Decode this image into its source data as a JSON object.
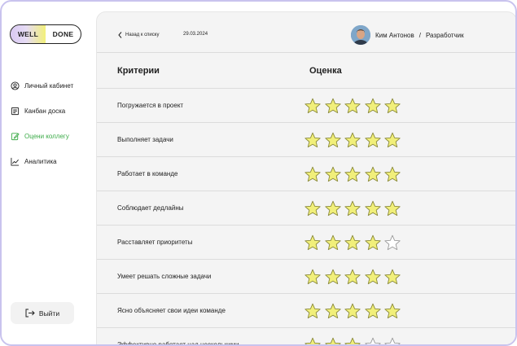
{
  "logo": {
    "part1": "WELL",
    "part2": "DONE"
  },
  "sidebar": {
    "items": [
      {
        "label": "Личный кабинет",
        "icon": "user-circle-icon",
        "active": false
      },
      {
        "label": "Канбан доска",
        "icon": "board-icon",
        "active": false
      },
      {
        "label": "Оцени коллегу",
        "icon": "edit-icon",
        "active": true
      },
      {
        "label": "Аналитика",
        "icon": "chart-line-icon",
        "active": false
      }
    ],
    "logout_label": "Выйти"
  },
  "header": {
    "back_label": "Назад к списку",
    "date": "29.03.2024",
    "user_name": "Ким Антонов",
    "separator": "/",
    "user_role": "Разработчик"
  },
  "table": {
    "col_criteria": "Критерии",
    "col_rating": "Оценка",
    "rows": [
      {
        "criterion": "Погружается в проект",
        "rating": 5
      },
      {
        "criterion": "Выполняет задачи",
        "rating": 5
      },
      {
        "criterion": "Работает в команде",
        "rating": 5
      },
      {
        "criterion": "Соблюдает дедлайны",
        "rating": 5
      },
      {
        "criterion": "Расставляет приоритеты",
        "rating": 4
      },
      {
        "criterion": "Умеет решать сложные задачи",
        "rating": 5
      },
      {
        "criterion": "Ясно объясняет свои идеи команде",
        "rating": 5
      },
      {
        "criterion": "Эффективно работает над несколькими",
        "rating": 3
      }
    ],
    "max_rating": 5
  },
  "colors": {
    "star_fill": "#f1ef7a",
    "star_stroke": "#8a8a3a",
    "active_nav": "#3cab48",
    "accent_border": "#c9c3ee"
  }
}
